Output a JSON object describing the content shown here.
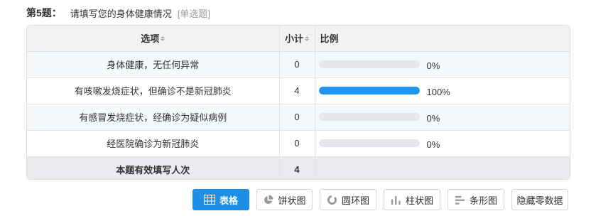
{
  "question": {
    "number": "第5题：",
    "text": "请填写您的身体健康情况",
    "type": "[单选题]"
  },
  "table": {
    "headers": {
      "option": "选项",
      "count": "小计",
      "ratio": "比例"
    },
    "rows": [
      {
        "option": "身体健康，无任何异常",
        "count": "0",
        "percent": "0%",
        "fill": 0
      },
      {
        "option": "有咳嗽发烧症状，但确诊不是新冠肺炎",
        "count": "4",
        "percent": "100%",
        "fill": 1
      },
      {
        "option": "有感冒发烧症状，经确诊为疑似病例",
        "count": "0",
        "percent": "0%",
        "fill": 0
      },
      {
        "option": "经医院确诊为新冠肺炎",
        "count": "0",
        "percent": "0%",
        "fill": 0
      }
    ],
    "total": {
      "label": "本题有效填写人次",
      "count": "4"
    }
  },
  "toolbar": {
    "table": "表格",
    "pie": "饼状图",
    "ring": "圆环图",
    "column": "柱状图",
    "bar": "条形图",
    "hide_zero": "隐藏零数据"
  },
  "colors": {
    "accent": "#1e8fe6",
    "bar_fill": "#2196f3",
    "bar_track": "#e5e7eb"
  }
}
